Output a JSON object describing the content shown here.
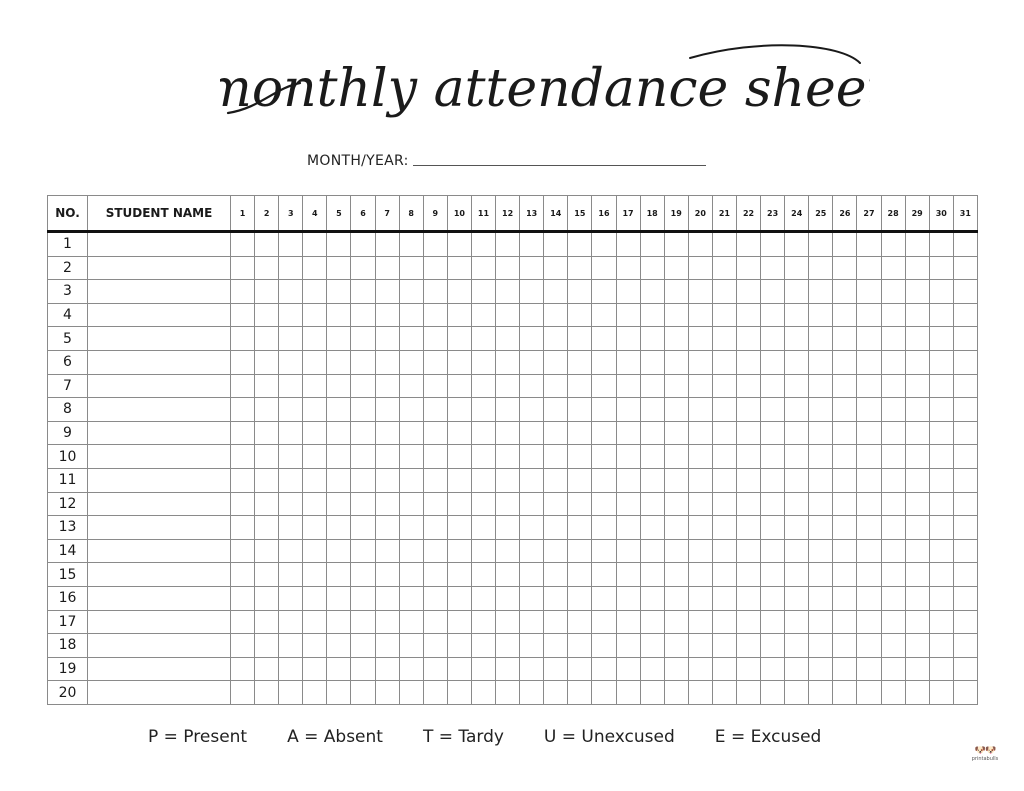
{
  "page": {
    "title": "monthly attendance sheet",
    "month_year_label": "MONTH/YEAR:",
    "month_year_value": ""
  },
  "table": {
    "headers": {
      "no": "NO.",
      "student_name": "STUDENT NAME",
      "days": [
        "1",
        "2",
        "3",
        "4",
        "5",
        "6",
        "7",
        "8",
        "9",
        "10",
        "11",
        "12",
        "13",
        "14",
        "15",
        "16",
        "17",
        "18",
        "19",
        "20",
        "21",
        "22",
        "23",
        "24",
        "25",
        "26",
        "27",
        "28",
        "29",
        "30",
        "31"
      ]
    },
    "rows": [
      {
        "no": "1",
        "name": ""
      },
      {
        "no": "2",
        "name": ""
      },
      {
        "no": "3",
        "name": ""
      },
      {
        "no": "4",
        "name": ""
      },
      {
        "no": "5",
        "name": ""
      },
      {
        "no": "6",
        "name": ""
      },
      {
        "no": "7",
        "name": ""
      },
      {
        "no": "8",
        "name": ""
      },
      {
        "no": "9",
        "name": ""
      },
      {
        "no": "10",
        "name": ""
      },
      {
        "no": "11",
        "name": ""
      },
      {
        "no": "12",
        "name": ""
      },
      {
        "no": "13",
        "name": ""
      },
      {
        "no": "14",
        "name": ""
      },
      {
        "no": "15",
        "name": ""
      },
      {
        "no": "16",
        "name": ""
      },
      {
        "no": "17",
        "name": ""
      },
      {
        "no": "18",
        "name": ""
      },
      {
        "no": "19",
        "name": ""
      },
      {
        "no": "20",
        "name": ""
      }
    ]
  },
  "legend": [
    "P = Present",
    "A = Absent",
    "T = Tardy",
    "U = Unexcused",
    "E = Excused"
  ],
  "branding": {
    "logo_icon": "dog-faces-icon",
    "logo_text": "printabulls"
  },
  "colors": {
    "ink": "#1a1a1a",
    "grid": "#8a8a8a",
    "background": "#ffffff"
  }
}
